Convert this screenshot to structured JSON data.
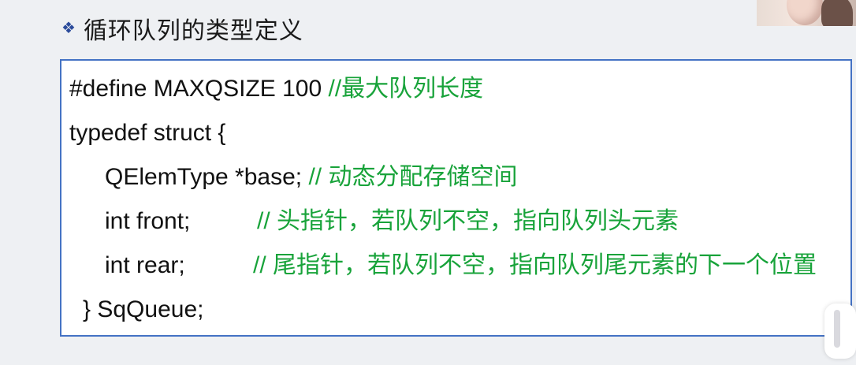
{
  "heading": {
    "bullet": "❖",
    "title": "循环队列的类型定义"
  },
  "code": {
    "line1": {
      "code": "#define MAXQSIZE 100 ",
      "comment": "//最大队列长度"
    },
    "line2": {
      "code": "typedef struct {"
    },
    "line3": {
      "code": "QElemType *base; ",
      "comment": "// 动态分配存储空间"
    },
    "line4": {
      "code": "int front;",
      "comment": "// 头指针，若队列不空，指向队列头元素"
    },
    "line5": {
      "code": "int rear;",
      "comment": "// 尾指针，若队列不空，指向队列尾元素的下一个位置"
    },
    "line6": {
      "code": "} SqQueue;"
    }
  },
  "colors": {
    "comment": "#18a33a",
    "border": "#4472c4",
    "bullet": "#2b4b9b"
  }
}
